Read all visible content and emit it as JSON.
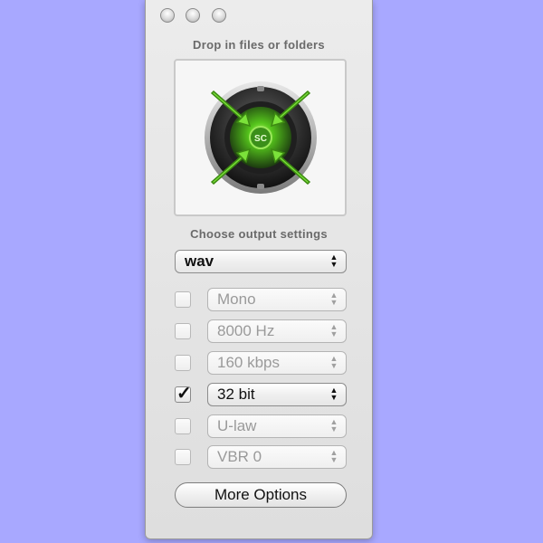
{
  "window": {
    "drop_label": "Drop in files or folders",
    "settings_label": "Choose output settings",
    "speaker_logo_text": "SC"
  },
  "output": {
    "format": "wav",
    "options": [
      {
        "label": "Mono",
        "checked": false,
        "enabled": false
      },
      {
        "label": "8000 Hz",
        "checked": false,
        "enabled": false
      },
      {
        "label": "160 kbps",
        "checked": false,
        "enabled": false
      },
      {
        "label": "32 bit",
        "checked": true,
        "enabled": true
      },
      {
        "label": "U-law",
        "checked": false,
        "enabled": false
      },
      {
        "label": "VBR 0",
        "checked": false,
        "enabled": false
      }
    ],
    "checkmark": "✓"
  },
  "more_options_label": "More Options",
  "colors": {
    "background": "#a8a8ff",
    "arrow_green": "#7be23a",
    "speaker_dark": "#2a2a2a"
  }
}
